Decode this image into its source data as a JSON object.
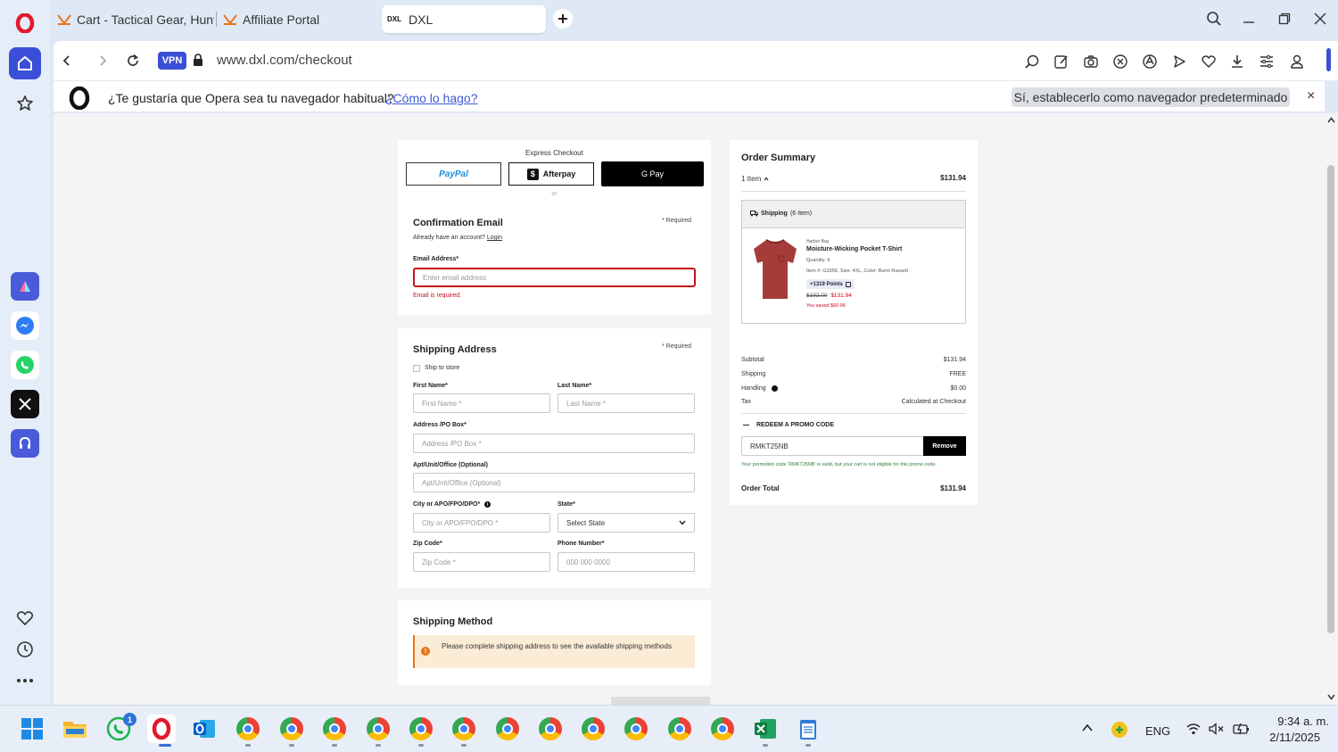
{
  "browser": {
    "tabs": [
      {
        "title": "Cart - Tactical Gear, Huntir",
        "favicon": "dxl-logo-icon"
      },
      {
        "title": "Affiliate Portal",
        "favicon": "dxl-logo-icon"
      },
      {
        "title": "DXL",
        "favicon": "dxl-logo-icon",
        "active": true
      }
    ],
    "vpn_label": "VPN",
    "url": "www.dxl.com/checkout",
    "infobar": {
      "text": "¿Te gustaría que Opera sea tu navegador habitual?",
      "link": "¿Cómo lo hago?",
      "button": "Sí, establecerlo como navegador predeterminado",
      "close": "×"
    }
  },
  "checkout": {
    "express_title": "Express Checkout",
    "paypal": "PayPal",
    "afterpay": "Afterpay",
    "gpay": "G Pay",
    "or": "or",
    "email_section": {
      "title": "Confirmation Email",
      "required": "* Required",
      "account_text": "Already have an account?",
      "login": "Login",
      "email_label": "Email Address*",
      "email_placeholder": "Enter email address",
      "error": "Email is required."
    },
    "shipping_address": {
      "title": "Shipping Address",
      "required": "* Required",
      "ship_to_store": "Ship to store",
      "first_name_label": "First Name*",
      "first_name_placeholder": "First Name *",
      "last_name_label": "Last Name*",
      "last_name_placeholder": "Last Name *",
      "address_label": "Address /PO Box*",
      "address_placeholder": "Address /PO Box *",
      "apt_label": "Apt/Unit/Office (Optional)",
      "apt_placeholder": "Apt/Unit/Office (Optional)",
      "city_label": "City or APO/FPO/DPO*",
      "city_placeholder": "City or APO/FPO/DPO *",
      "state_label": "State*",
      "state_value": "Select State",
      "zip_label": "Zip Code*",
      "zip_placeholder": "Zip Code *",
      "phone_label": "Phone Number*",
      "phone_placeholder": "000 000 0000"
    },
    "shipping_method": {
      "title": "Shipping Method",
      "notice": "Please complete shipping address to see the available shipping methods"
    }
  },
  "order_summary": {
    "title": "Order Summary",
    "items_count": "1 Item",
    "items_total": "$131.94",
    "shipping_header": "Shipping",
    "shipping_items": "(6 Item)",
    "product": {
      "brand": "Harbor Bay",
      "name": "Moisture-Wicking Pocket T-Shirt",
      "quantity": "Quantity: 6",
      "details": "Item #: G3356, Size: 4XL, Color: Burnt Russett",
      "points": "+1319 Points",
      "old_price": "$192.00",
      "price": "$131.94",
      "saved": "You saved $60.06"
    },
    "subtotal_label": "Subtotal",
    "subtotal": "$131.94",
    "shipping_label": "Shipping",
    "shipping": "FREE",
    "handling_label": "Handling",
    "handling": "$0.00",
    "tax_label": "Tax",
    "tax": "Calculated at Checkout",
    "promo_toggle": "REDEEM A PROMO CODE",
    "promo_code": "RMKT25NB",
    "remove": "Remove",
    "promo_message": "Your promotion code 'RMKT25NB' is valid, but your cart is not eligible for this promo code.",
    "order_total_label": "Order Total",
    "order_total": "$131.94"
  },
  "taskbar": {
    "language": "ENG",
    "time": "9:34 a. m.",
    "date": "2/11/2025",
    "whatsapp_badge": "1"
  },
  "colors": {
    "opera_red": "#e3192b",
    "accent_blue": "#3b4fd6",
    "error_red": "#c4121a",
    "sale_red": "#d0021b",
    "notice_bg": "#fbecd6",
    "notice_orange": "#e8731a"
  }
}
